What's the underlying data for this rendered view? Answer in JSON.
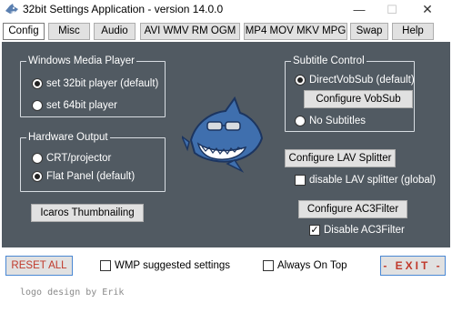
{
  "window": {
    "title": "32bit Settings Application - version 14.0.0",
    "minimize": "—",
    "maximize": "☐",
    "close": "✕"
  },
  "tabs": [
    {
      "label": "Config",
      "active": true
    },
    {
      "label": "Misc",
      "active": false
    },
    {
      "label": "Audio",
      "active": false
    },
    {
      "label": "AVI WMV RM OGM",
      "active": false
    },
    {
      "label": "MP4 MOV MKV MPG",
      "active": false
    },
    {
      "label": "Swap",
      "active": false
    },
    {
      "label": "Help",
      "active": false
    }
  ],
  "windows_media_player": {
    "legend": "Windows Media Player",
    "options": [
      {
        "label": "set 32bit player (default)",
        "selected": true
      },
      {
        "label": "set 64bit player",
        "selected": false
      }
    ]
  },
  "hardware_output": {
    "legend": "Hardware Output",
    "options": [
      {
        "label": "CRT/projector",
        "selected": false
      },
      {
        "label": "Flat Panel (default)",
        "selected": true
      }
    ]
  },
  "icaros_button": "Icaros Thumbnailing",
  "subtitle_control": {
    "legend": "Subtitle Control",
    "options": [
      {
        "label": "DirectVobSub (default)",
        "selected": true
      },
      {
        "label": "No Subtitles",
        "selected": false
      }
    ],
    "configure_button": "Configure VobSub"
  },
  "lav": {
    "configure_button": "Configure LAV Splitter",
    "disable_label": "disable LAV splitter (global)",
    "disable_checked": false
  },
  "ac3": {
    "configure_button": "Configure AC3Filter",
    "disable_label": "Disable AC3Filter",
    "disable_checked": true
  },
  "bottom": {
    "reset_button": "RESET ALL",
    "wmp_label": "WMP suggested settings",
    "wmp_checked": false,
    "always_on_top_label": "Always On Top",
    "always_on_top_checked": false,
    "exit_button": "- EXIT -"
  },
  "footer_note": "logo design by Erik",
  "colors": {
    "panel": "#515a62",
    "accent_red": "#c0392b",
    "focus_blue": "#0078d7"
  }
}
